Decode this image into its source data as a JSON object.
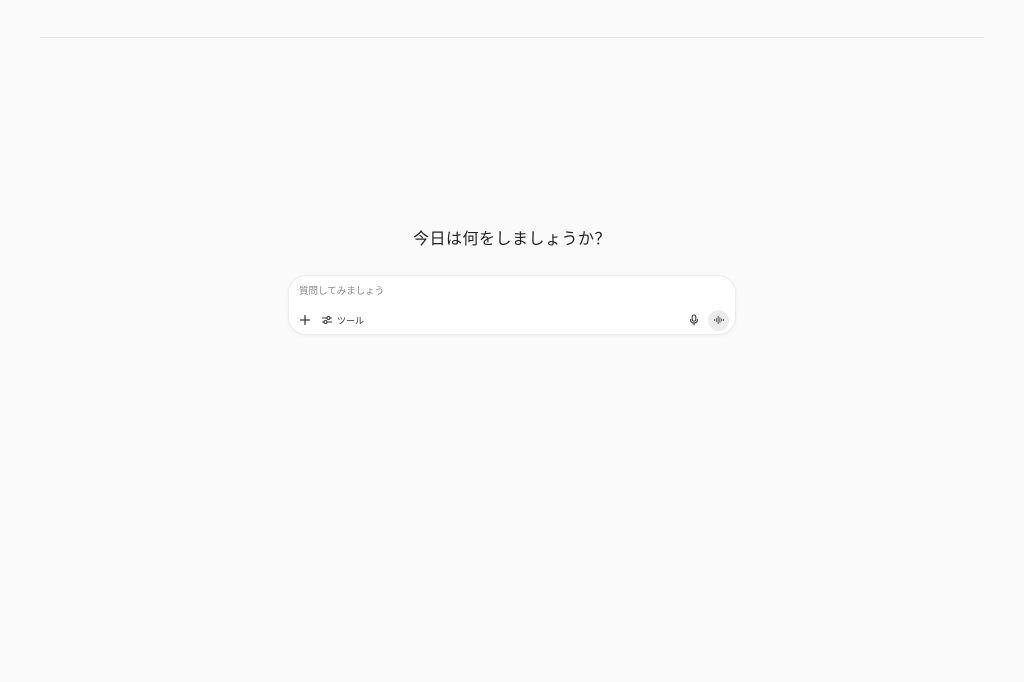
{
  "greeting": "今日は何をしましょうか？",
  "composer": {
    "placeholder": "質問してみましょう",
    "value": "",
    "tools_label": "ツール",
    "icons": {
      "add": "plus-icon",
      "tools": "tools-sliders-icon",
      "mic": "microphone-icon",
      "voice": "voice-waveform-icon"
    }
  },
  "colors": {
    "background": "#fafafa",
    "composer_bg": "#ffffff",
    "voice_button_bg": "#ececec",
    "text": "#222222",
    "placeholder": "#8a8a8a"
  }
}
